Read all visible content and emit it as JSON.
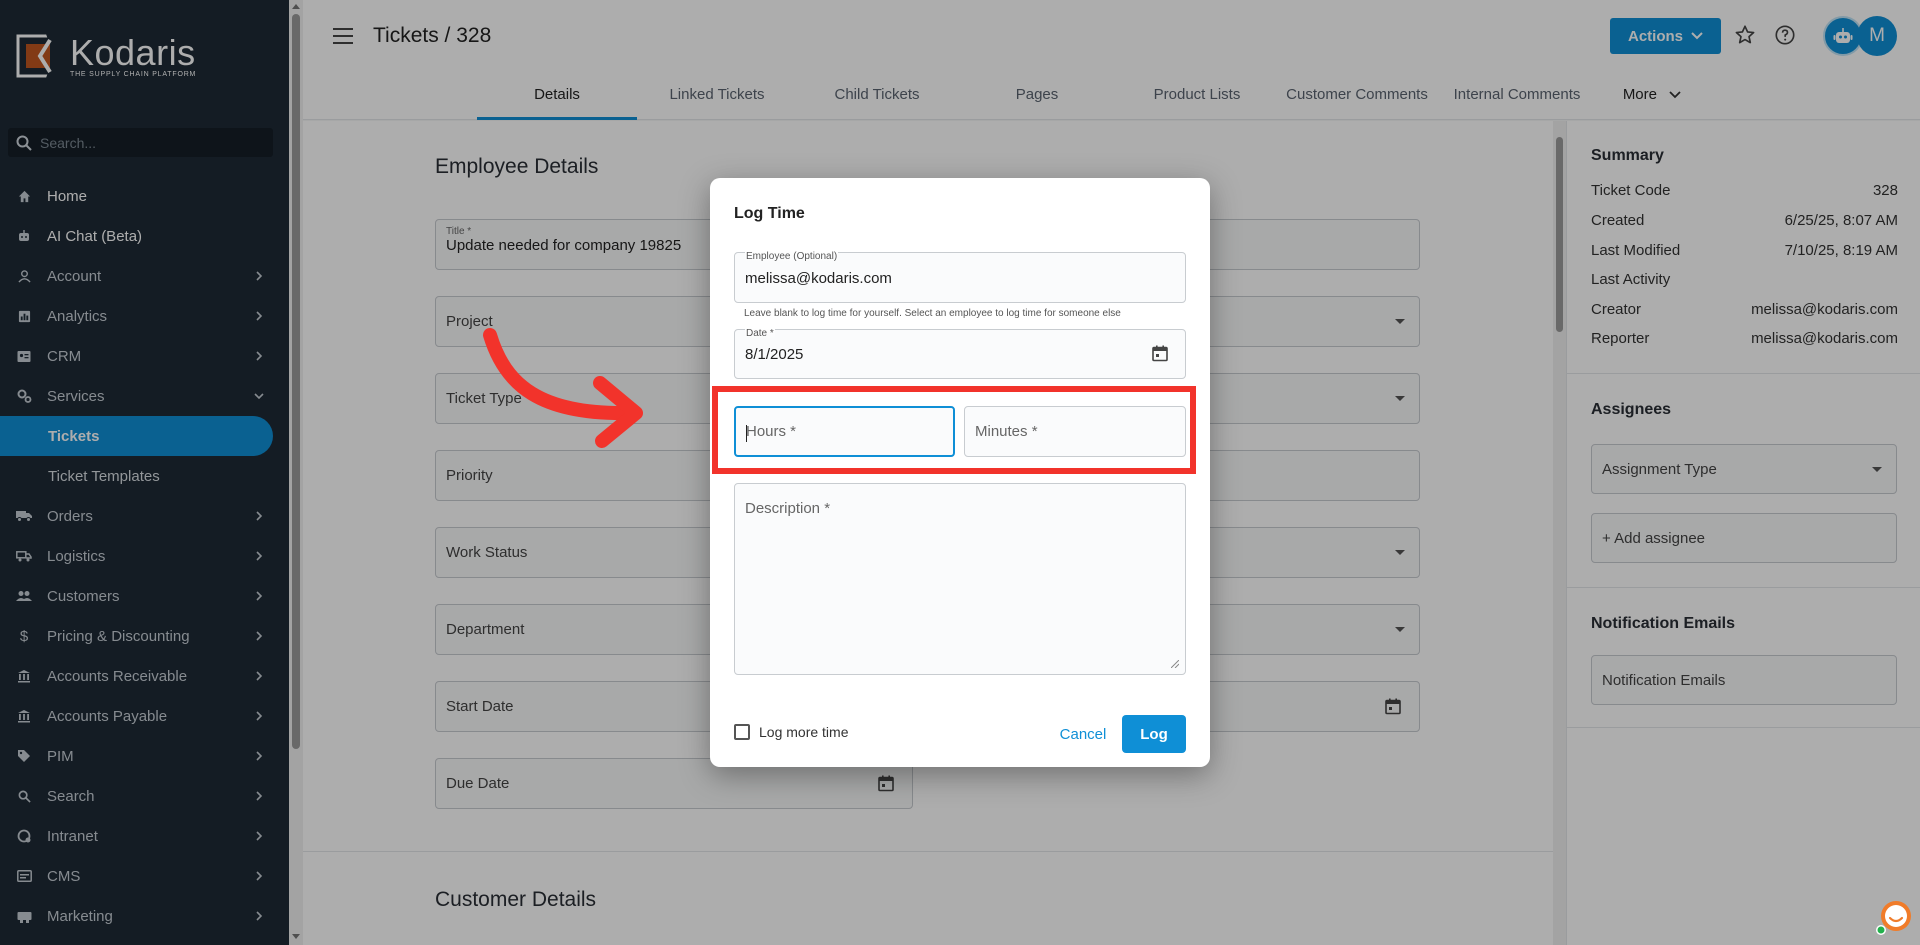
{
  "sidebar": {
    "logo_name": "Kodaris",
    "logo_tagline": "THE SUPPLY CHAIN PLATFORM",
    "search_placeholder": "Search...",
    "items": [
      {
        "label": "Home",
        "icon": "home-icon"
      },
      {
        "label": "AI Chat (Beta)",
        "icon": "robot-icon"
      },
      {
        "label": "Account",
        "icon": "person-icon"
      },
      {
        "label": "Analytics",
        "icon": "chart-icon"
      },
      {
        "label": "CRM",
        "icon": "contact-card-icon"
      },
      {
        "label": "Services",
        "icon": "gears-icon"
      },
      {
        "label": "Tickets",
        "icon": ""
      },
      {
        "label": "Ticket Templates",
        "icon": ""
      },
      {
        "label": "Orders",
        "icon": "truck-icon"
      },
      {
        "label": "Logistics",
        "icon": "shipping-icon"
      },
      {
        "label": "Customers",
        "icon": "people-icon"
      },
      {
        "label": "Pricing & Discounting",
        "icon": "dollar-icon"
      },
      {
        "label": "Accounts Receivable",
        "icon": "bank-icon"
      },
      {
        "label": "Accounts Payable",
        "icon": "bank-icon"
      },
      {
        "label": "PIM",
        "icon": "tag-icon"
      },
      {
        "label": "Search",
        "icon": "search-icon"
      },
      {
        "label": "Intranet",
        "icon": "globe-icon"
      },
      {
        "label": "CMS",
        "icon": "cms-icon"
      },
      {
        "label": "Marketing",
        "icon": "megaphone-icon"
      }
    ]
  },
  "header": {
    "title": "Tickets / 328",
    "actions_label": "Actions",
    "avatar_initial": "M",
    "tabs": [
      "Details",
      "Linked Tickets",
      "Child Tickets",
      "Pages",
      "Product Lists",
      "Customer Comments",
      "Internal Comments",
      "More"
    ]
  },
  "form": {
    "employee_section": "Employee Details",
    "title_label": "Title *",
    "title_value": "Update needed for company 19825",
    "project": "Project",
    "ticket_type": "Ticket Type",
    "priority": "Priority",
    "work_status": "Work Status",
    "department": "Department",
    "start_date": "Start Date",
    "due_date": "Due Date",
    "customer_section": "Customer Details"
  },
  "summary": {
    "title": "Summary",
    "rows": [
      {
        "label": "Ticket Code",
        "value": "328"
      },
      {
        "label": "Created",
        "value": "6/25/25, 8:07 AM"
      },
      {
        "label": "Last Modified",
        "value": "7/10/25, 8:19 AM"
      },
      {
        "label": "Last Activity",
        "value": ""
      },
      {
        "label": "Creator",
        "value": "melissa@kodaris.com"
      },
      {
        "label": "Reporter",
        "value": "melissa@kodaris.com"
      }
    ],
    "assignees_title": "Assignees",
    "assignment_type": "Assignment Type",
    "add_assignee": "+ Add assignee",
    "notification_title": "Notification Emails",
    "notification_placeholder": "Notification Emails"
  },
  "dialog": {
    "title": "Log Time",
    "employee_label": "Employee (Optional)",
    "employee_value": "melissa@kodaris.com",
    "employee_hint": "Leave blank to log time for yourself. Select an employee to log time for someone else",
    "date_label": "Date *",
    "date_value": "8/1/2025",
    "hours_placeholder": "Hours *",
    "minutes_placeholder": "Minutes *",
    "description_placeholder": "Description *",
    "log_more_label": "Log more time",
    "log_more_checked": false,
    "cancel_label": "Cancel",
    "log_label": "Log"
  },
  "colors": {
    "accent": "#0f8fd6",
    "sidebar_bg": "#1e2a36",
    "annotation_red": "#f2332b"
  }
}
